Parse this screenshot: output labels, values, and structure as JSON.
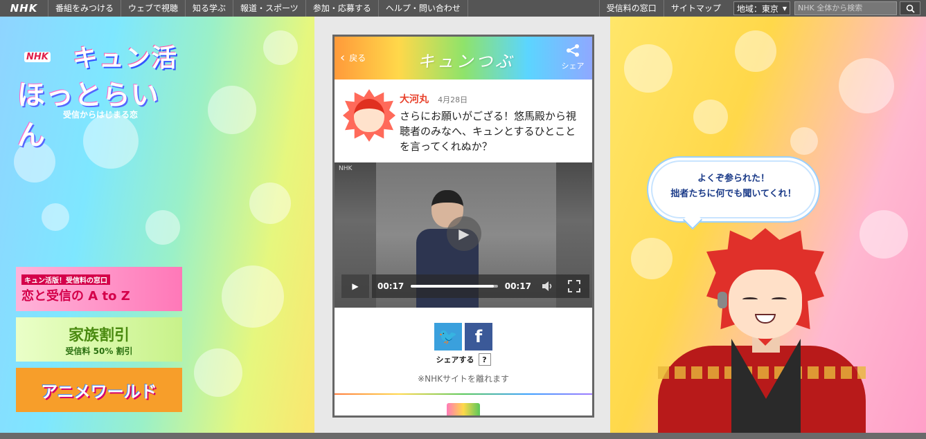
{
  "nav": {
    "logo": "NHK",
    "items": [
      "番組をみつける",
      "ウェブで視聴",
      "知る学ぶ",
      "報道・スポーツ",
      "参加・応募する",
      "ヘルプ・問い合わせ"
    ],
    "right_items": [
      "受信料の窓口",
      "サイトマップ"
    ],
    "region_label": "地域：東京",
    "search_placeholder": "NHK 全体から検索"
  },
  "show_logo": {
    "nhk": "NHK",
    "line1": "キュン活",
    "line2": "ほっとらいん",
    "tagline": "受信からはじまる恋"
  },
  "banners": {
    "b1_sub": "キュン活版！受信料の窓口",
    "b1_main": "恋と受信の A to Z",
    "b2_main": "家族割引",
    "b2_sub": "受信料 50% 割引",
    "b3_main": "アニメワールド"
  },
  "phone": {
    "back_label": "戻る",
    "title": "キュンつぶ",
    "share_label": "シェア",
    "post": {
      "author": "大河丸",
      "date": "4月28日",
      "text": "さらにお願いがござる！悠馬殿から視聴者のみなへ、キュンとするひとことを言ってくれぬか？"
    },
    "video": {
      "nhk_mark": "NHK",
      "current_time": "00:17",
      "duration": "00:17",
      "progress": 0.95
    },
    "share_area": {
      "share_button": "シェアする",
      "help": "?",
      "leave_note": "※NHKサイトを離れます"
    }
  },
  "speech": {
    "line1": "よくぞ参られた！",
    "line2": "拙者たちに何でも聞いてくれ！"
  },
  "icons": {
    "search": "search-icon",
    "share": "share-icon",
    "twitter": "twitter-icon",
    "facebook": "facebook-icon"
  }
}
